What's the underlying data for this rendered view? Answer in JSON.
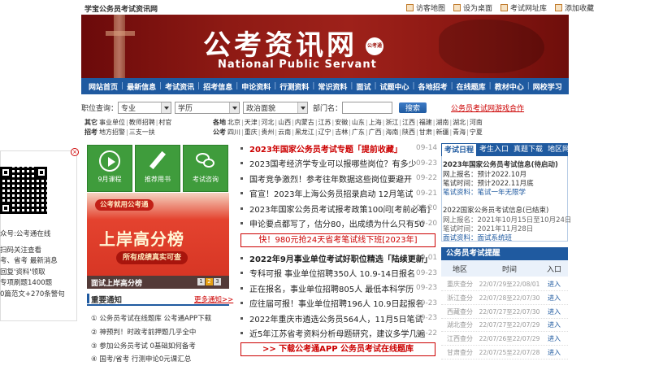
{
  "top": {
    "site_name": "学宝公务员考试资讯网",
    "links": [
      "访客地图",
      "设为桌面",
      "考试网址库",
      "添加收藏"
    ]
  },
  "banner": {
    "title": "公考资讯网",
    "subtitle": "National Public Servant",
    "badge": "公考通"
  },
  "nav": [
    "网站首页",
    "最新信息",
    "考试资讯",
    "招考信息",
    "申论资料",
    "行测资料",
    "常识资料",
    "面试",
    "试题中心",
    "各地招考",
    "在线题库",
    "教材中心",
    "网校学习"
  ],
  "search": {
    "label_position": "职位查询：",
    "major": "专业",
    "education": "学历",
    "politics": "政治面貌",
    "label_dept": "部门名：",
    "button": "搜索",
    "guide_link": "公务员考试网游戏合作"
  },
  "categories": {
    "other_label1": "其它",
    "other_label2": "招考",
    "other_row1": [
      "事业单位",
      "教师招聘",
      "村官"
    ],
    "other_row2": [
      "地方招警",
      "三支一扶"
    ],
    "region_label1": "各地",
    "region_label2": "公考",
    "region_row1": [
      "北京",
      "天津",
      "河北",
      "山西",
      "内蒙古",
      "江苏",
      "安徽",
      "山东",
      "上海",
      "浙江",
      "江西",
      "福建",
      "湖南",
      "湖北",
      "河南"
    ],
    "region_row2": [
      "四川",
      "重庆",
      "贵州",
      "云南",
      "黑龙江",
      "辽宁",
      "吉林",
      "广东",
      "广西",
      "海南",
      "陕西",
      "甘肃",
      "新疆",
      "青海",
      "宁夏"
    ]
  },
  "qr_panel": {
    "close": "×",
    "lines": [
      "众号:公考通在线",
      "扫码关注查看",
      "考、省考 最新消息",
      "回复'资料'领取",
      "专项刷题1400题",
      "0篇范文+270条警句"
    ]
  },
  "tiles": [
    {
      "label": "9月课程",
      "icon": "play-icon"
    },
    {
      "label": "推荐用书",
      "icon": "pencil-icon"
    },
    {
      "label": "考试咨询",
      "icon": "wechat-icon"
    }
  ],
  "promo": {
    "chip": "公考就用公考通",
    "title": "上岸高分榜",
    "sub": "所有成绩真实可查",
    "caption": "面试上岸高分榜",
    "pages": [
      "1",
      "2",
      "3"
    ]
  },
  "notices": {
    "title": "重要通知",
    "more": "更多通知>>",
    "items": [
      "① 公务员考试在线题库 公考通APP下载",
      "② 神预判！时政考前押题几乎全中",
      "③ 参加公务员考试 0基础如何备考",
      "④ 国考/省考 行测申论0元课汇总"
    ]
  },
  "news": [
    {
      "text": "2023年国家公务员考试专题「提前收藏」",
      "date": "09-14",
      "style": "red"
    },
    {
      "text": "2023国考经济学专业可以报哪些岗位？有多少",
      "date": "09-23",
      "style": ""
    },
    {
      "text": "国考竞争激烈！参考往年数据这些岗位要避开",
      "date": "09-22",
      "style": ""
    },
    {
      "text": "官宣！2023年上海公务员招录启动 12月笔试",
      "date": "09-21",
      "style": ""
    },
    {
      "text": "2023年国家公务员考试报考政策100问[考前必看]",
      "date": "09-20",
      "style": ""
    },
    {
      "text": "申论要点都写了，估分80，出成绩为什么只有50",
      "date": "09-20",
      "style": ""
    }
  ],
  "box_link1": "快！980元抢24天省考笔试线下班[2023年]",
  "news2": [
    {
      "text": "2022年9月事业单位考试好职位精选「陆续更新」",
      "date": "09-01",
      "style": "bold"
    },
    {
      "text": "专科可报 事业单位招聘350人 10.9-14日报名",
      "date": "09-23",
      "style": ""
    },
    {
      "text": "正在报名，事业单位招聘805人 最低本科学历",
      "date": "09-23",
      "style": ""
    },
    {
      "text": "应往届可报！事业单位招聘196人 10.9日起报名",
      "date": "09-23",
      "style": ""
    },
    {
      "text": "2022年重庆市遴选公务员564人，11月5日笔试",
      "date": "09-23",
      "style": ""
    },
    {
      "text": "近5年江苏省考资料分析母题研究，建议多学几遍",
      "date": "09-22",
      "style": ""
    }
  ],
  "box_link2": ">> 下载公考通APP 公务员考试在线题库",
  "right_tabs": [
    "考试日程",
    "考生入口",
    "真题下载",
    "地区网站"
  ],
  "schedule": {
    "item1_title": "2023年国家公务员考试信息(待启动)",
    "item1_line1": "网上报名：预计2022.10月",
    "item1_line2": "笔试时间：预计2022.11月底",
    "item1_link": "笔试资料：笔试一年无限学",
    "item2_title": "2022国家公务员考试信息(已结束)",
    "item2_line1": "网上报名：2021年10月15日至10月24日",
    "item2_line2": "笔试时间：2021年11月28日",
    "item2_link": "面试资料：面试系统班"
  },
  "remind": {
    "title": "公务员考试提醒",
    "headers": [
      "地区",
      "时间",
      "入口"
    ],
    "rows": [
      {
        "name": "重庆查分",
        "time": "22/07/29至22/08/01",
        "enter": "进入"
      },
      {
        "name": "浙江查分",
        "time": "22/07/28至22/07/30",
        "enter": "进入"
      },
      {
        "name": "西藏查分",
        "time": "22/07/27至22/07/30",
        "enter": "进入"
      },
      {
        "name": "湖北查分",
        "time": "22/07/27至22/07/29",
        "enter": "进入"
      },
      {
        "name": "江西查分",
        "time": "22/07/26至22/07/29",
        "enter": "进入"
      },
      {
        "name": "甘肃查分",
        "time": "22/07/25至22/07/28",
        "enter": "进入"
      }
    ]
  },
  "colors": {
    "brand_blue": "#1f5aa0",
    "brand_red": "#a01c15",
    "tile_green": "#3f9c3c"
  }
}
